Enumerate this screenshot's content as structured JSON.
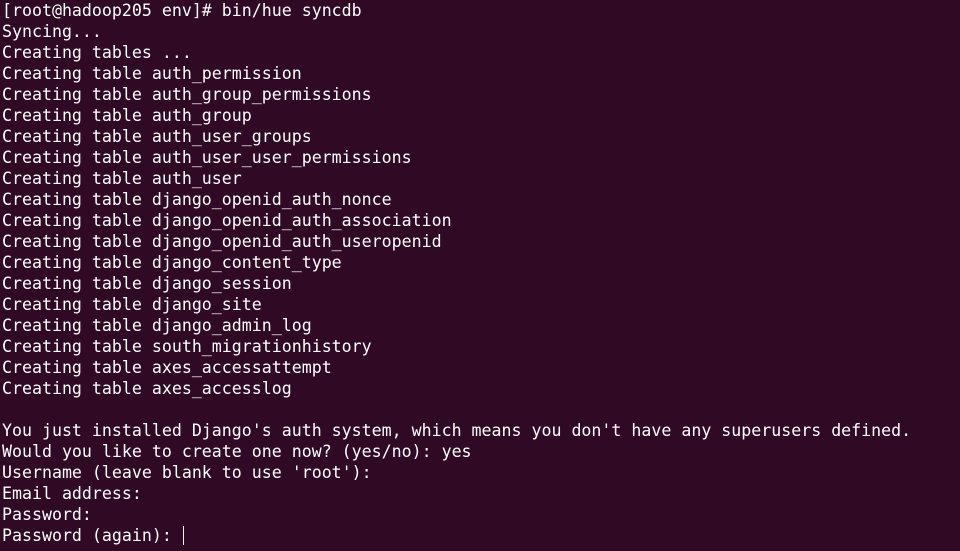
{
  "terminal": {
    "background": "#300a24",
    "foreground": "#ffffff",
    "lines": [
      "[root@hadoop205 env]# bin/hue syncdb",
      "Syncing...",
      "Creating tables ...",
      "Creating table auth_permission",
      "Creating table auth_group_permissions",
      "Creating table auth_group",
      "Creating table auth_user_groups",
      "Creating table auth_user_user_permissions",
      "Creating table auth_user",
      "Creating table django_openid_auth_nonce",
      "Creating table django_openid_auth_association",
      "Creating table django_openid_auth_useropenid",
      "Creating table django_content_type",
      "Creating table django_session",
      "Creating table django_site",
      "Creating table django_admin_log",
      "Creating table south_migrationhistory",
      "Creating table axes_accessattempt",
      "Creating table axes_accesslog",
      "",
      "You just installed Django's auth system, which means you don't have any superusers defined.",
      "Would you like to create one now? (yes/no): yes",
      "Username (leave blank to use 'root'):",
      "Email address:",
      "Password:"
    ],
    "prompt": "Password (again): "
  }
}
